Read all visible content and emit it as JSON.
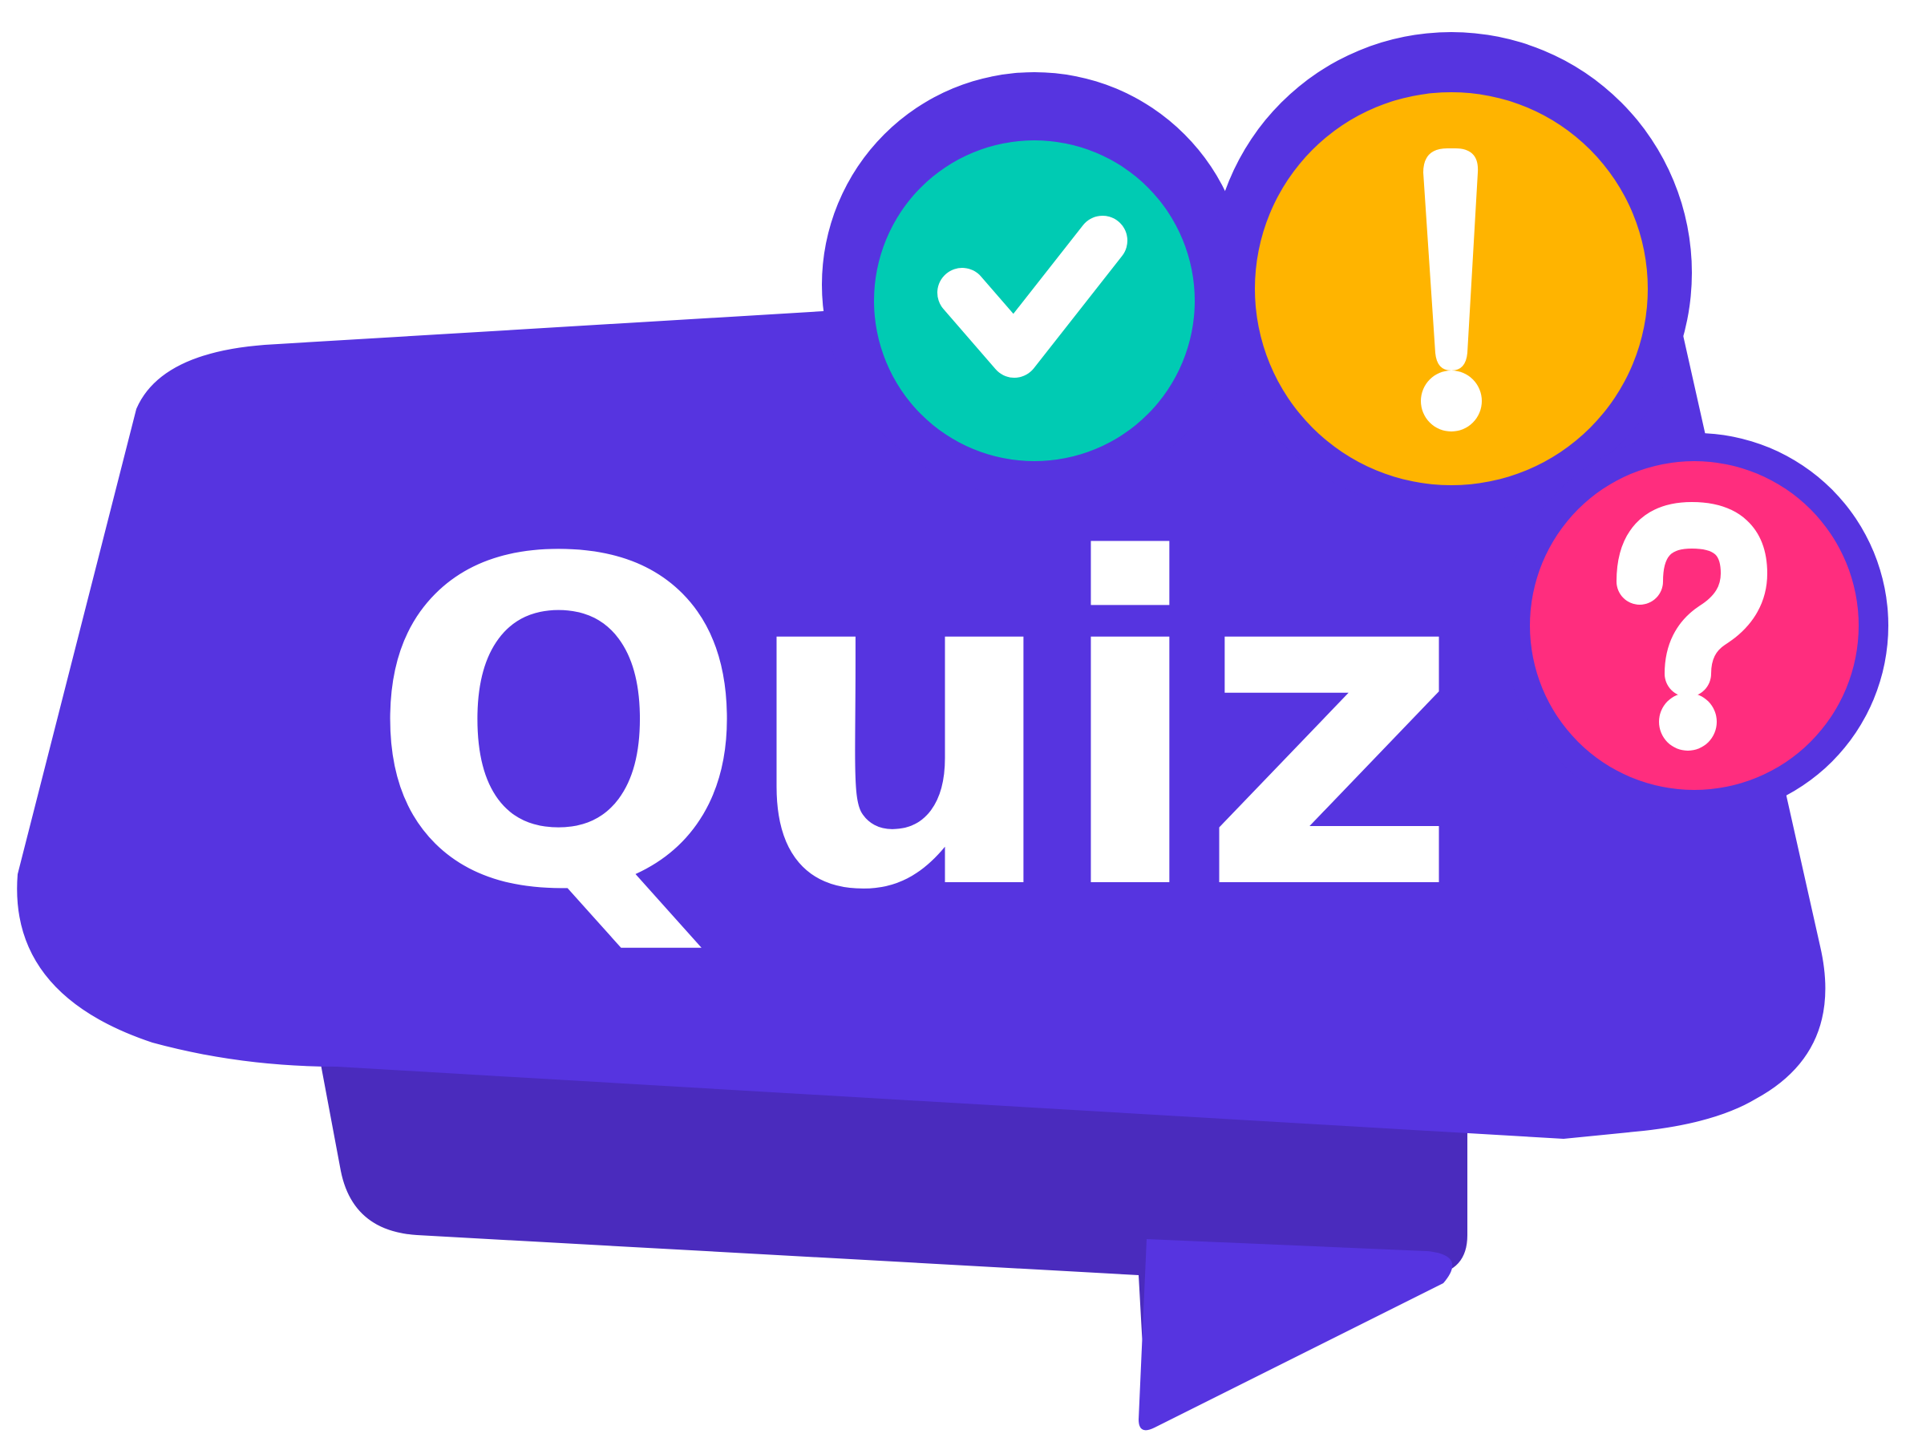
{
  "logo": {
    "word": "Quiz",
    "badges": [
      {
        "icon": "check-icon"
      },
      {
        "icon": "exclamation-icon"
      },
      {
        "icon": "question-icon"
      }
    ]
  },
  "colors": {
    "background": "#ffffff",
    "bubble": "#5634e0",
    "bubble_outline": "#5634e0",
    "fold_shadow": "#4a2bbd",
    "text": "#ffffff",
    "check_badge": "#00cbb3",
    "exclamation_badge": "#ffb400",
    "question_badge": "#ff2d7e"
  }
}
